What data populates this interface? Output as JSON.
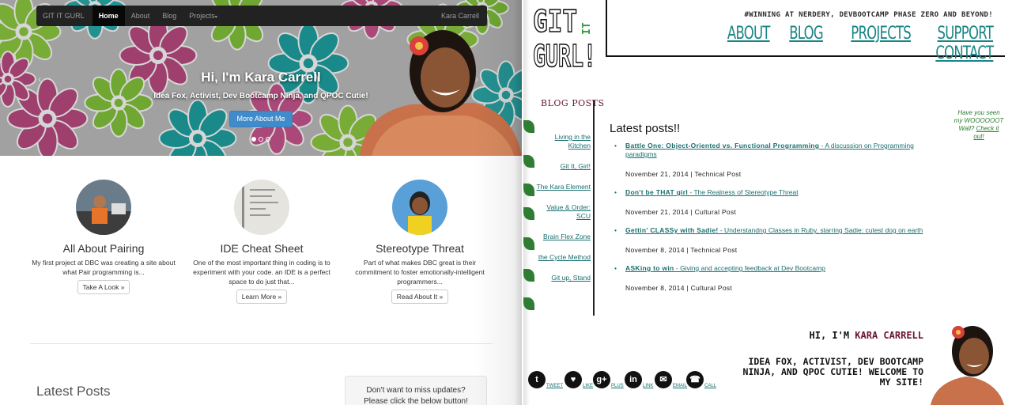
{
  "left": {
    "navbar": {
      "brand": "GIT IT GURL",
      "items": [
        {
          "label": "Home",
          "active": true
        },
        {
          "label": "About",
          "active": false
        },
        {
          "label": "Blog",
          "active": false
        },
        {
          "label": "Projects",
          "active": false
        }
      ],
      "user": "Kara Carrell"
    },
    "hero": {
      "title": "Hi, I'm Kara Carrell",
      "subtitle": "Idea Fox, Activist, Dev Bootcamp Ninja, and QPOC Cutie!",
      "button": "More About Me",
      "slides": 3,
      "active_slide": 1
    },
    "columns": [
      {
        "heading": "All About Pairing",
        "text": "My first project at DBC was creating a site about what Pair programming is...",
        "button": "Take A Look »"
      },
      {
        "heading": "IDE Cheat Sheet",
        "text": "One of the most important thing in coding is to experiment with your code. an IDE is a perfect space to do just that...",
        "button": "Learn More »"
      },
      {
        "heading": "Stereotype Threat",
        "text": "Part of what makes DBC great is their commitment to foster emotionally-intelligent programmers...",
        "button": "Read About It »"
      }
    ],
    "latest_heading": "Latest Posts",
    "updates_box": {
      "line1": "Don't want to miss updates?",
      "line2": "Please click the below button!"
    }
  },
  "right": {
    "logo_text": "GIT IT GURL!",
    "tagline": "#WINNING AT NERDERY, DEVBOOTCAMP PHASE ZERO AND BEYOND!",
    "menu": [
      "ABOUT",
      "BLOG",
      "PROJECTS",
      "SUPPORT",
      "CONTACT"
    ],
    "sidebar_heading": "BLOG POSTS",
    "sidebar_links": [
      "Living in the Kitchen",
      "Git It, Girl!",
      "The Kara Element",
      "Value & Order: SCU",
      "Brain Flex Zone",
      "the Cycle Method",
      "Git up, Stand"
    ],
    "posts_heading": "Latest posts!!",
    "posts": [
      {
        "title": "Battle One: Object-Oriented vs. Functional Programming",
        "desc": " - A discussion on Programming paradigms",
        "date": "November 21, 2014",
        "category": "Technical Post"
      },
      {
        "title": "Don't be THAT girl",
        "desc": " - The Realness of Stereotype Threat",
        "date": "November 21, 2014",
        "category": "Cultural Post"
      },
      {
        "title": "Gettin' CLASSy with Sadie!",
        "desc": " - Understandng Classes in Ruby, starring Sadie: cutest dog on earth",
        "date": "November 8, 2014",
        "category": "Technical Post"
      },
      {
        "title": "ASKing to win",
        "desc": " - Giving and accepting feedback at Dev Bootcamp",
        "date": "November 8, 2014",
        "category": "Cultural Post"
      }
    ],
    "wall_note": {
      "text": "Have you seen my WOOOOOOT Wall?",
      "link": "Check it out!"
    },
    "bio": {
      "greeting": "HI, I'M ",
      "name": "KARA CARRELL",
      "text": "IDEA FOX, ACTIVIST, DEV BOOTCAMP NINJA, AND QPOC CUTIE! WELCOME TO MY SITE!"
    },
    "social": [
      {
        "icon": "twitter-icon",
        "glyph": "t",
        "label": "TWEET"
      },
      {
        "icon": "heart-icon",
        "glyph": "♥",
        "label": "LIKE"
      },
      {
        "icon": "google-plus-icon",
        "glyph": "g+",
        "label": "PLUS"
      },
      {
        "icon": "linkedin-icon",
        "glyph": "in",
        "label": "LINK"
      },
      {
        "icon": "email-icon",
        "glyph": "✉",
        "label": "EMAIL"
      },
      {
        "icon": "phone-icon",
        "glyph": "☎",
        "label": "CALL"
      }
    ]
  },
  "colors": {
    "teal": "#1a8585",
    "maroon": "#6b1530",
    "leaf_green": "#2e7d32",
    "navbar": "#222222",
    "primary_button": "#428bca"
  }
}
